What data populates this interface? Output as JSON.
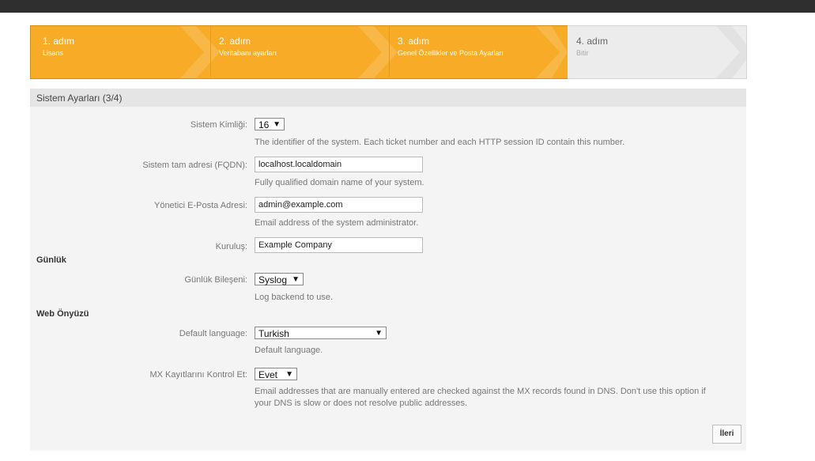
{
  "wizard": {
    "steps": [
      {
        "title": "1. adım",
        "sub": "Lisans"
      },
      {
        "title": "2. adım",
        "sub": "Veritabanı ayarları"
      },
      {
        "title": "3. adım",
        "sub": "Genel Özellikler ve Posta Ayarları"
      },
      {
        "title": "4. adım",
        "sub": "Bitir"
      }
    ]
  },
  "panel": {
    "title": "Sistem Ayarları (3/4)"
  },
  "fields": {
    "system_id": {
      "label": "Sistem Kimliği:",
      "value": "16",
      "hint": "The identifier of the system. Each ticket number and each HTTP session ID contain this number."
    },
    "fqdn": {
      "label": "Sistem tam adresi (FQDN):",
      "value": "localhost.localdomain",
      "hint": "Fully qualified domain name of your system."
    },
    "admin_email": {
      "label": "Yönetici E-Posta Adresi:",
      "value": "admin@example.com",
      "hint": "Email address of the system administrator."
    },
    "organization": {
      "label": "Kuruluş:",
      "value": "Example Company"
    },
    "log_module": {
      "label": "Günlük Bileşeni:",
      "value": "Syslog",
      "hint": "Log backend to use."
    },
    "default_language": {
      "label": "Default language:",
      "value": "Turkish",
      "hint": "Default language."
    },
    "mx_check": {
      "label": "MX Kayıtlarını Kontrol Et:",
      "value": "Evet",
      "hint_line1": "Email addresses that are manually entered are checked against the MX records found in DNS. Don't use this option if",
      "hint_line2": "your DNS is slow or does not resolve public addresses."
    }
  },
  "sections": {
    "log": "Günlük",
    "web": "Web Önyüzü"
  },
  "buttons": {
    "next": "İleri"
  },
  "icons": {
    "select_arrow": "▼"
  }
}
